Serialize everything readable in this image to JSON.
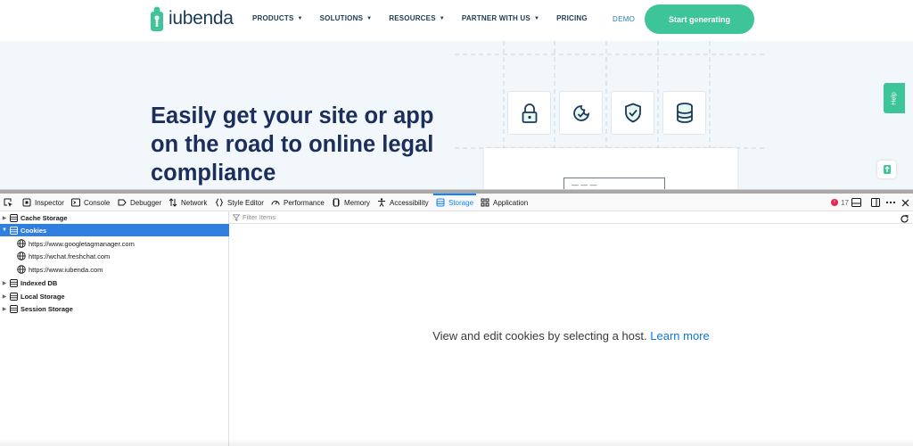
{
  "site": {
    "logo_text": "iubenda",
    "nav": [
      {
        "label": "PRODUCTS",
        "has_caret": true
      },
      {
        "label": "SOLUTIONS",
        "has_caret": true
      },
      {
        "label": "RESOURCES",
        "has_caret": true
      },
      {
        "label": "PARTNER WITH US",
        "has_caret": true
      },
      {
        "label": "PRICING",
        "has_caret": false
      }
    ],
    "demo_label": "DEMO",
    "cta_label": "Start generating",
    "hero_lines": [
      "Easily get your site or app",
      "on the road to online legal",
      "compliance"
    ],
    "feature_icons": [
      "lock-icon",
      "cookie-check-icon",
      "shield-check-icon",
      "database-icon"
    ],
    "doc_field_text": "— — —",
    "help_label": "Help",
    "colors": {
      "brand_green": "#3ec499",
      "navy": "#1b2e5c",
      "hero_bg": "#f2f7fb"
    }
  },
  "devtools": {
    "tabs": [
      {
        "label": "Inspector",
        "icon": "inspector-icon",
        "active": false
      },
      {
        "label": "Console",
        "icon": "console-icon",
        "active": false
      },
      {
        "label": "Debugger",
        "icon": "debugger-icon",
        "active": false
      },
      {
        "label": "Network",
        "icon": "network-icon",
        "active": false
      },
      {
        "label": "Style Editor",
        "icon": "style-editor-icon",
        "active": false
      },
      {
        "label": "Performance",
        "icon": "performance-icon",
        "active": false
      },
      {
        "label": "Memory",
        "icon": "memory-icon",
        "active": false
      },
      {
        "label": "Accessibility",
        "icon": "accessibility-icon",
        "active": false
      },
      {
        "label": "Storage",
        "icon": "storage-icon",
        "active": true
      },
      {
        "label": "Application",
        "icon": "application-icon",
        "active": false
      }
    ],
    "error_count": "17",
    "storage_tree": [
      {
        "label": "Cache Storage",
        "type": "category",
        "expanded": false,
        "selected": false
      },
      {
        "label": "Cookies",
        "type": "category",
        "expanded": true,
        "selected": true
      },
      {
        "label": "https://www.googletagmanager.com",
        "type": "host",
        "selected": false
      },
      {
        "label": "https://wchat.freshchat.com",
        "type": "host",
        "selected": false
      },
      {
        "label": "https://www.iubenda.com",
        "type": "host",
        "selected": false
      },
      {
        "label": "Indexed DB",
        "type": "category",
        "expanded": false,
        "selected": false
      },
      {
        "label": "Local Storage",
        "type": "category",
        "expanded": false,
        "selected": false
      },
      {
        "label": "Session Storage",
        "type": "category",
        "expanded": false,
        "selected": false
      }
    ],
    "filter_placeholder": "Filter Items",
    "empty_message": "View and edit cookies by selecting a host.",
    "learn_more": "Learn more",
    "colors": {
      "accent": "#0a84ff",
      "selected_row": "#2f7ee2",
      "error": "#e22850"
    }
  }
}
